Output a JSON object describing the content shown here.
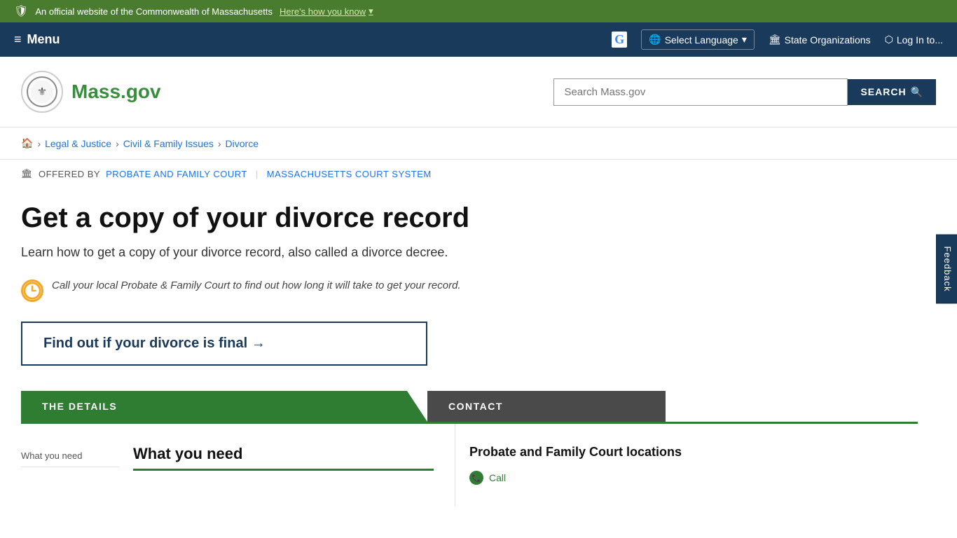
{
  "top_banner": {
    "official_text": "An official website of the Commonwealth of Massachusetts",
    "heres_how": "Here's how you know"
  },
  "nav": {
    "menu_label": "Menu",
    "select_language": "Select Language",
    "state_organizations": "State Organizations",
    "log_in": "Log In to..."
  },
  "header": {
    "logo_text": "Mass.gov",
    "search_placeholder": "Search Mass.gov",
    "search_button": "SEARCH"
  },
  "breadcrumb": {
    "home_icon": "🏠",
    "items": [
      {
        "label": "Legal & Justice",
        "href": "#"
      },
      {
        "label": "Civil & Family Issues",
        "href": "#"
      },
      {
        "label": "Divorce",
        "href": "#"
      }
    ]
  },
  "offered_by": {
    "label": "OFFERED BY",
    "providers": [
      {
        "name": "Probate and Family Court",
        "href": "#"
      },
      {
        "name": "Massachusetts Court System",
        "href": "#"
      }
    ]
  },
  "page": {
    "title": "Get a copy of your divorce record",
    "subtitle": "Learn how to get a copy of your divorce record, also called a divorce decree.",
    "notice": "Call your local Probate & Family Court to find out how long it will take to get your record.",
    "find_out_link": "Find out if your divorce is final →",
    "tab_details": "THE DETAILS",
    "tab_contact": "CONTACT",
    "section_what_you_need_sidebar": "What you need",
    "section_what_you_need_main": "What you need",
    "contact_heading": "Probate and Family Court locations",
    "contact_item": "Call"
  },
  "feedback": {
    "label": "Feedback"
  }
}
